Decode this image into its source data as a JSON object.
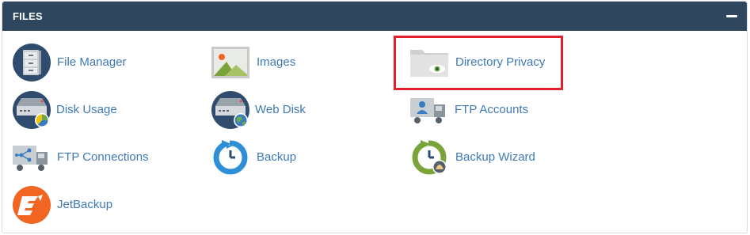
{
  "panel": {
    "title": "FILES",
    "collapse_icon": "minus-icon"
  },
  "items": [
    {
      "label": "File Manager",
      "icon": "file-cabinet-icon"
    },
    {
      "label": "Images",
      "icon": "image-icon"
    },
    {
      "label": "Directory Privacy",
      "icon": "folder-eye-icon"
    },
    {
      "label": "Disk Usage",
      "icon": "disk-usage-icon"
    },
    {
      "label": "Web Disk",
      "icon": "web-disk-icon"
    },
    {
      "label": "FTP Accounts",
      "icon": "ftp-accounts-icon"
    },
    {
      "label": "FTP Connections",
      "icon": "ftp-connections-icon"
    },
    {
      "label": "Backup",
      "icon": "backup-icon"
    },
    {
      "label": "Backup Wizard",
      "icon": "backup-wizard-icon"
    },
    {
      "label": "JetBackup",
      "icon": "jetbackup-icon"
    }
  ],
  "colors": {
    "header_bg": "#2e475f",
    "link": "#3e79b5",
    "highlight": "#e0212c"
  }
}
